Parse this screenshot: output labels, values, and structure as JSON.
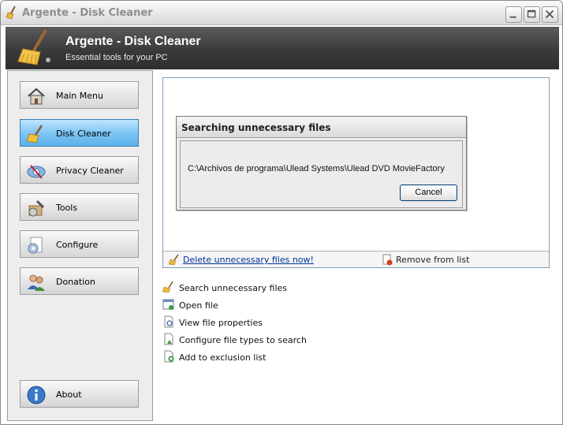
{
  "window": {
    "title": "Argente - Disk Cleaner"
  },
  "banner": {
    "title": "Argente - Disk Cleaner",
    "subtitle": "Essential tools for your PC"
  },
  "nav": {
    "items": [
      {
        "label": "Main Menu",
        "icon": "house-icon",
        "active": false
      },
      {
        "label": "Disk Cleaner",
        "icon": "broom-icon",
        "active": true
      },
      {
        "label": "Privacy Cleaner",
        "icon": "privacy-icon",
        "active": false
      },
      {
        "label": "Tools",
        "icon": "tools-icon",
        "active": false
      },
      {
        "label": "Configure",
        "icon": "configure-icon",
        "active": false
      },
      {
        "label": "Donation",
        "icon": "users-icon",
        "active": false
      }
    ],
    "about": {
      "label": "About",
      "icon": "info-icon"
    }
  },
  "results": {
    "delete_link": "Delete unnecessary files now!",
    "remove_label": "Remove from list"
  },
  "dialog": {
    "title": "Searching unnecessary files",
    "path": "C:\\Archivos de programa\\Ulead Systems\\Ulead DVD MovieFactory",
    "cancel_label": "Cancel"
  },
  "actions": [
    {
      "label": "Search unnecessary files",
      "icon": "broom-icon"
    },
    {
      "label": "Open file",
      "icon": "open-file-icon"
    },
    {
      "label": "View file properties",
      "icon": "file-properties-icon"
    },
    {
      "label": "Configure file types to search",
      "icon": "file-configure-icon"
    },
    {
      "label": "Add to exclusion list",
      "icon": "add-exclusion-icon"
    }
  ],
  "colors": {
    "accent": "#7ec6f4",
    "banner": "#3a3a3a",
    "link": "#003399"
  }
}
